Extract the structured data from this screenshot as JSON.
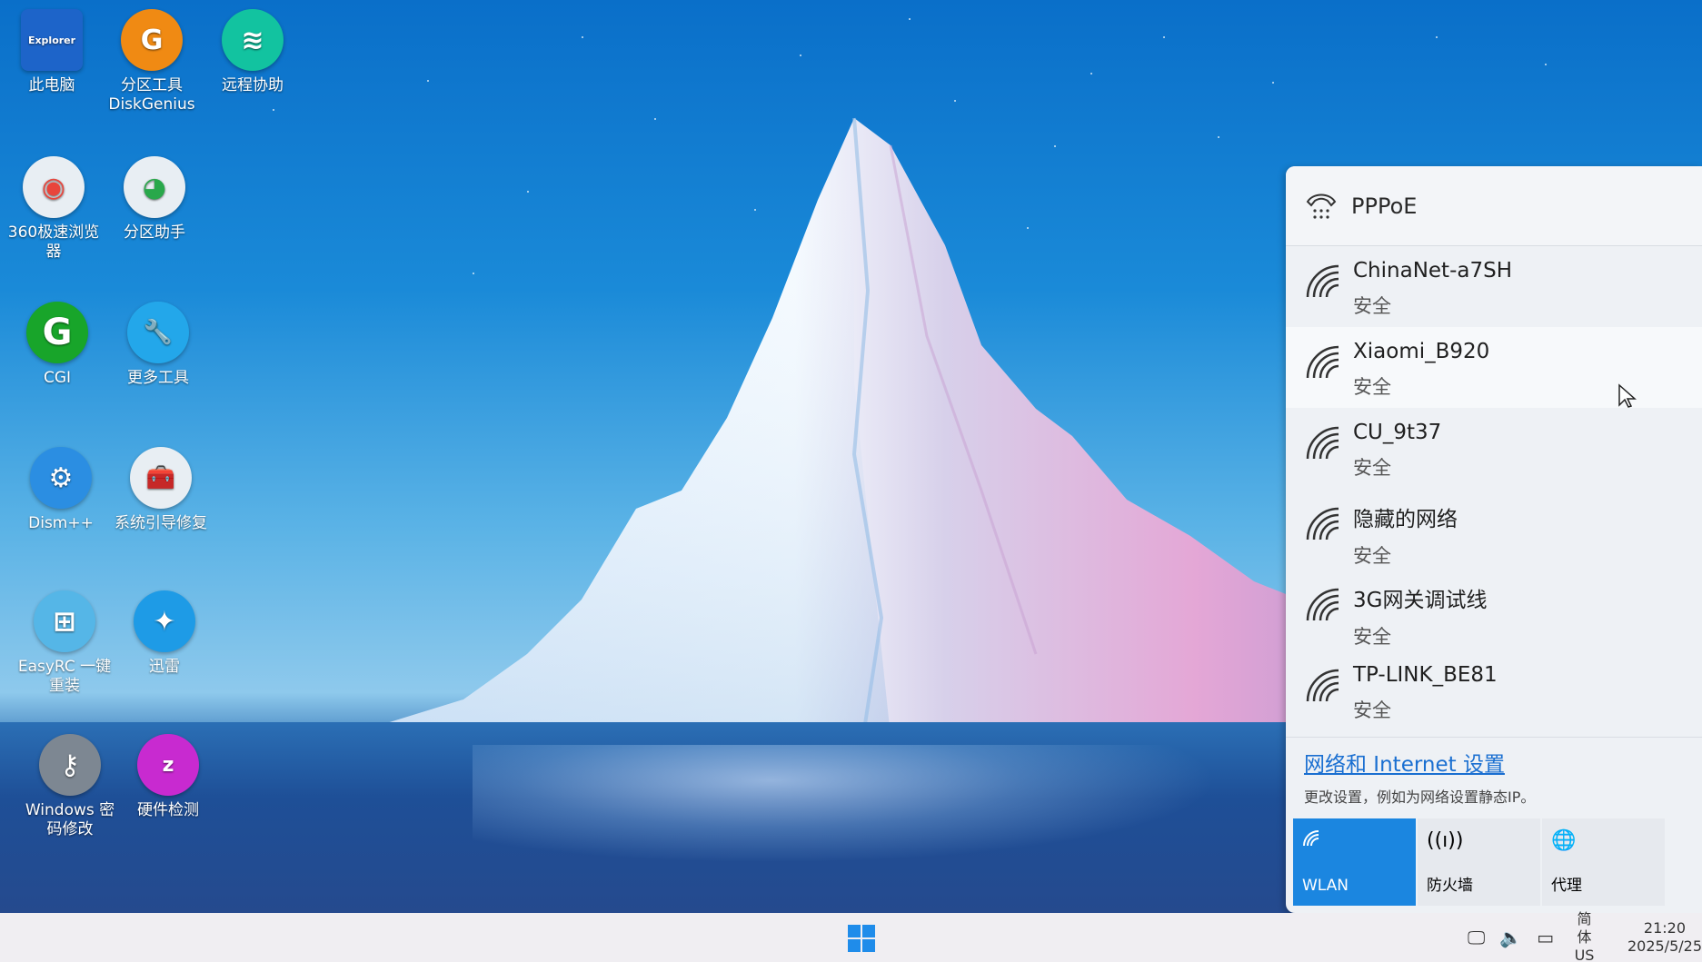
{
  "desktop": {
    "icons": [
      {
        "label": "此电脑",
        "icon": "explorer-icon",
        "color": "#1d64c9",
        "glyph": "Explorer"
      },
      {
        "label": "分区工具\nDiskGenius",
        "icon": "diskgenius-icon",
        "color": "#f08a13",
        "glyph": "G"
      },
      {
        "label": "远程协助",
        "icon": "remote-assist-icon",
        "color": "#12c3a0",
        "glyph": "≋"
      },
      {
        "label": "360极速浏览\n器",
        "icon": "browser-360-icon",
        "color": "#e8eef3",
        "glyph": "◉"
      },
      {
        "label": "分区助手",
        "icon": "partition-assistant-icon",
        "color": "#e8eef3",
        "glyph": "◕"
      },
      {
        "label": "CGI",
        "icon": "cgi-icon",
        "color": "#18a52a",
        "glyph": "G"
      },
      {
        "label": "更多工具",
        "icon": "more-tools-icon",
        "color": "#23a7ea",
        "glyph": "🔧"
      },
      {
        "label": "Dism++",
        "icon": "dism-icon",
        "color": "#2b8ee2",
        "glyph": "⚙"
      },
      {
        "label": "系统引导修复",
        "icon": "boot-repair-icon",
        "color": "#e8eef3",
        "glyph": "🧰"
      },
      {
        "label": "EasyRC 一键\n重装",
        "icon": "easyrc-icon",
        "color": "#55b6e7",
        "glyph": "⊞"
      },
      {
        "label": "迅雷",
        "icon": "thunder-icon",
        "color": "#1e9be6",
        "glyph": "✦"
      },
      {
        "label": "Windows 密\n码修改",
        "icon": "password-key-icon",
        "color": "#7d8792",
        "glyph": "⚷"
      },
      {
        "label": "硬件检测",
        "icon": "hardware-detect-icon",
        "color": "#c82ad0",
        "glyph": "z"
      }
    ]
  },
  "flyout": {
    "pppoe": {
      "label": "PPPoE",
      "icon": "dialup-phone-icon"
    },
    "networks": [
      {
        "ssid": "ChinaNet-a7SH",
        "security": "安全"
      },
      {
        "ssid": "Xiaomi_B920",
        "security": "安全"
      },
      {
        "ssid": "CU_9t37",
        "security": "安全"
      },
      {
        "ssid": "隐藏的网络",
        "security": "安全"
      },
      {
        "ssid": "3G网关调试线",
        "security": "安全"
      },
      {
        "ssid": "TP-LINK_BE81",
        "security": "安全"
      }
    ],
    "settings_link": "网络和 Internet 设置",
    "settings_desc": "更改设置，例如为网络设置静态IP。",
    "quick_actions": [
      {
        "label": "WLAN",
        "icon": "wifi-icon",
        "active": true
      },
      {
        "label": "防火墙",
        "icon": "antenna-icon",
        "active": false
      },
      {
        "label": "代理",
        "icon": "globe-icon",
        "active": false
      }
    ]
  },
  "taskbar": {
    "start_icon": "windows-start-icon",
    "tray_icons": [
      "network-display-icon",
      "volume-icon",
      "battery-icon"
    ],
    "ime_top": "简体",
    "ime_bottom": "US",
    "time": "21:20",
    "date": "2025/5/25"
  },
  "colors": {
    "accent": "#1b86e0",
    "link": "#1a6fd1"
  }
}
